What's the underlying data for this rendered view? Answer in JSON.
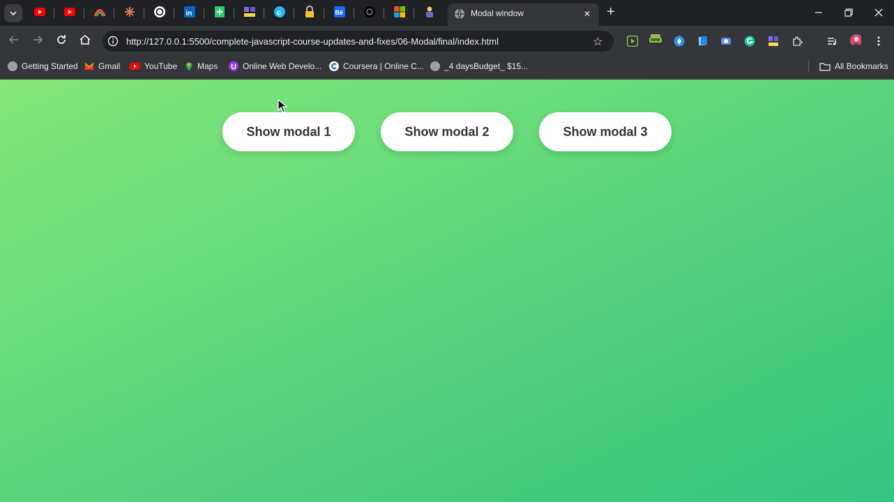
{
  "browser": {
    "tabs": {
      "active_title": "Modal window",
      "pinned_icons": [
        "youtube-icon",
        "youtube-icon",
        "arc-icon",
        "claude-icon",
        "chatgpt-icon",
        "linkedin-icon",
        "green-plus-icon",
        "team-icon",
        "circle-c-icon",
        "lock-icon",
        "behance-icon",
        "dark-logo-icon",
        "microsoft-icon",
        "figure-icon"
      ]
    },
    "address_bar": {
      "url": "http://127.0.0.1:5500/complete-javascript-course-updates-and-fixes/06-Modal/final/index.html"
    },
    "extension_badge": "new",
    "bookmarks": [
      {
        "label": "Getting Started",
        "icon": "globe-icon"
      },
      {
        "label": "Gmail",
        "icon": "gmail-icon"
      },
      {
        "label": "YouTube",
        "icon": "youtube-icon"
      },
      {
        "label": "Maps",
        "icon": "maps-icon"
      },
      {
        "label": "Online Web Develo...",
        "icon": "udemy-icon"
      },
      {
        "label": "Coursera | Online C...",
        "icon": "coursera-icon"
      },
      {
        "label": "_4 daysBudget_ $15...",
        "icon": "globe-icon"
      }
    ],
    "all_bookmarks_label": "All Bookmarks"
  },
  "page": {
    "buttons": [
      {
        "label": "Show modal 1"
      },
      {
        "label": "Show modal 2"
      },
      {
        "label": "Show modal 3"
      }
    ]
  },
  "colors": {
    "gradient_start": "#86e77a",
    "gradient_end": "#33c383",
    "button_bg": "#ffffff",
    "button_text": "#333333"
  }
}
